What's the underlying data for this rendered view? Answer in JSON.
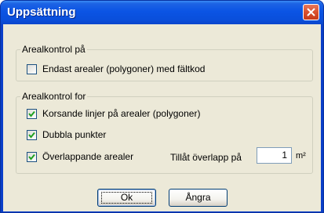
{
  "window": {
    "title": "Uppsättning"
  },
  "group1": {
    "legend": "Arealkontrol på",
    "options": [
      {
        "label": "Endast arealer (polygoner) med fältkod",
        "checked": false
      }
    ]
  },
  "group2": {
    "legend": "Arealkontrol for",
    "options": [
      {
        "label": "Korsande linjer på arealer (polygoner)",
        "checked": true
      },
      {
        "label": "Dubbla punkter",
        "checked": true
      },
      {
        "label": "Överlappande arealer",
        "checked": true
      }
    ],
    "overlap": {
      "label": "Tillåt överlapp på",
      "value": "1",
      "unit": "m²"
    }
  },
  "buttons": {
    "ok_label": "Ok",
    "cancel_label": "Ångra"
  },
  "colors": {
    "titlebar": "#0a54e4",
    "client_bg": "#ece9d8",
    "close_button": "#d9502e",
    "check_mark": "#21a121"
  }
}
